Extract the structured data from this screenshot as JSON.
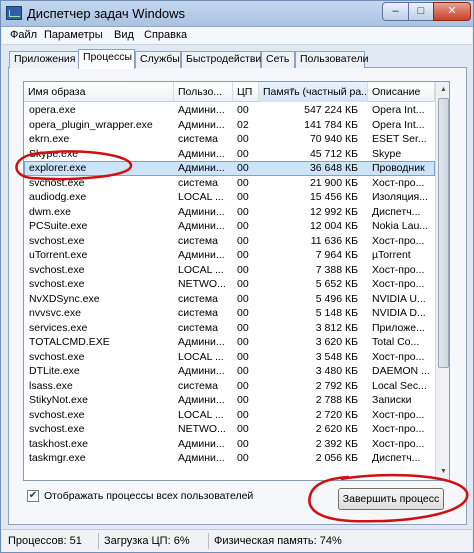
{
  "window": {
    "title": "Диспетчер задач Windows",
    "minimize": "–",
    "maximize": "□",
    "close": "✕"
  },
  "menu": [
    "Файл",
    "Параметры",
    "Вид",
    "Справка"
  ],
  "tabs": [
    "Приложения",
    "Процессы",
    "Службы",
    "Быстродействие",
    "Сеть",
    "Пользователи"
  ],
  "active_tab": "Процессы",
  "columns": [
    "Имя образа",
    "Пользо...",
    "ЦП",
    "Память (частный ра...",
    "Описание"
  ],
  "processes": [
    {
      "name": "opera.exe",
      "user": "Админи...",
      "cpu": "00",
      "mem": "547 224 КБ",
      "desc": "Opera Int..."
    },
    {
      "name": "opera_plugin_wrapper.exe",
      "user": "Админи...",
      "cpu": "02",
      "mem": "141 784 КБ",
      "desc": "Opera Int..."
    },
    {
      "name": "ekrn.exe",
      "user": "система",
      "cpu": "00",
      "mem": "70 940 КБ",
      "desc": "ESET Ser..."
    },
    {
      "name": "Skype.exe",
      "user": "Админи...",
      "cpu": "00",
      "mem": "45 712 КБ",
      "desc": "Skype"
    },
    {
      "name": "explorer.exe",
      "user": "Админи...",
      "cpu": "00",
      "mem": "36 648 КБ",
      "desc": "Проводник"
    },
    {
      "name": "svchost.exe",
      "user": "система",
      "cpu": "00",
      "mem": "21 900 КБ",
      "desc": "Хост-про..."
    },
    {
      "name": "audiodg.exe",
      "user": "LOCAL ...",
      "cpu": "00",
      "mem": "15 456 КБ",
      "desc": "Изоляция..."
    },
    {
      "name": "dwm.exe",
      "user": "Админи...",
      "cpu": "00",
      "mem": "12 992 КБ",
      "desc": "Диспетч..."
    },
    {
      "name": "PCSuite.exe",
      "user": "Админи...",
      "cpu": "00",
      "mem": "12 004 КБ",
      "desc": "Nokia Lau..."
    },
    {
      "name": "svchost.exe",
      "user": "система",
      "cpu": "00",
      "mem": "11 636 КБ",
      "desc": "Хост-про..."
    },
    {
      "name": "uTorrent.exe",
      "user": "Админи...",
      "cpu": "00",
      "mem": "7 964 КБ",
      "desc": "µTorrent"
    },
    {
      "name": "svchost.exe",
      "user": "LOCAL ...",
      "cpu": "00",
      "mem": "7 388 КБ",
      "desc": "Хост-про..."
    },
    {
      "name": "svchost.exe",
      "user": "NETWO...",
      "cpu": "00",
      "mem": "5 652 КБ",
      "desc": "Хост-про..."
    },
    {
      "name": "NvXDSync.exe",
      "user": "система",
      "cpu": "00",
      "mem": "5 496 КБ",
      "desc": "NVIDIA U..."
    },
    {
      "name": "nvvsvc.exe",
      "user": "система",
      "cpu": "00",
      "mem": "5 148 КБ",
      "desc": "NVIDIA D..."
    },
    {
      "name": "services.exe",
      "user": "система",
      "cpu": "00",
      "mem": "3 812 КБ",
      "desc": "Приложе..."
    },
    {
      "name": "TOTALCMD.EXE",
      "user": "Админи...",
      "cpu": "00",
      "mem": "3 620 КБ",
      "desc": "Total Co..."
    },
    {
      "name": "svchost.exe",
      "user": "LOCAL ...",
      "cpu": "00",
      "mem": "3 548 КБ",
      "desc": "Хост-про..."
    },
    {
      "name": "DTLite.exe",
      "user": "Админи...",
      "cpu": "00",
      "mem": "3 480 КБ",
      "desc": "DAEMON ..."
    },
    {
      "name": "lsass.exe",
      "user": "система",
      "cpu": "00",
      "mem": "2 792 КБ",
      "desc": "Local Sec..."
    },
    {
      "name": "StikyNot.exe",
      "user": "Админи...",
      "cpu": "00",
      "mem": "2 788 КБ",
      "desc": "Записки"
    },
    {
      "name": "svchost.exe",
      "user": "LOCAL ...",
      "cpu": "00",
      "mem": "2 720 КБ",
      "desc": "Хост-про..."
    },
    {
      "name": "svchost.exe",
      "user": "NETWO...",
      "cpu": "00",
      "mem": "2 620 КБ",
      "desc": "Хост-про..."
    },
    {
      "name": "taskhost.exe",
      "user": "Админи...",
      "cpu": "00",
      "mem": "2 392 КБ",
      "desc": "Хост-про..."
    },
    {
      "name": "taskmgr.exe",
      "user": "Админи...",
      "cpu": "00",
      "mem": "2 056 КБ",
      "desc": "Диспетч..."
    }
  ],
  "selected_process": "explorer.exe",
  "show_all_users": {
    "label": "Отображать процессы всех пользователей",
    "checked": true
  },
  "end_process_button": "Завершить процесс",
  "status": {
    "processes": "Процессов: 51",
    "cpu": "Загрузка ЦП: 6%",
    "memory": "Физическая память: 74%"
  },
  "colors": {
    "annotation": "#d01010",
    "selection": "#cde3f8",
    "titlebar": "#a9c3e3"
  }
}
